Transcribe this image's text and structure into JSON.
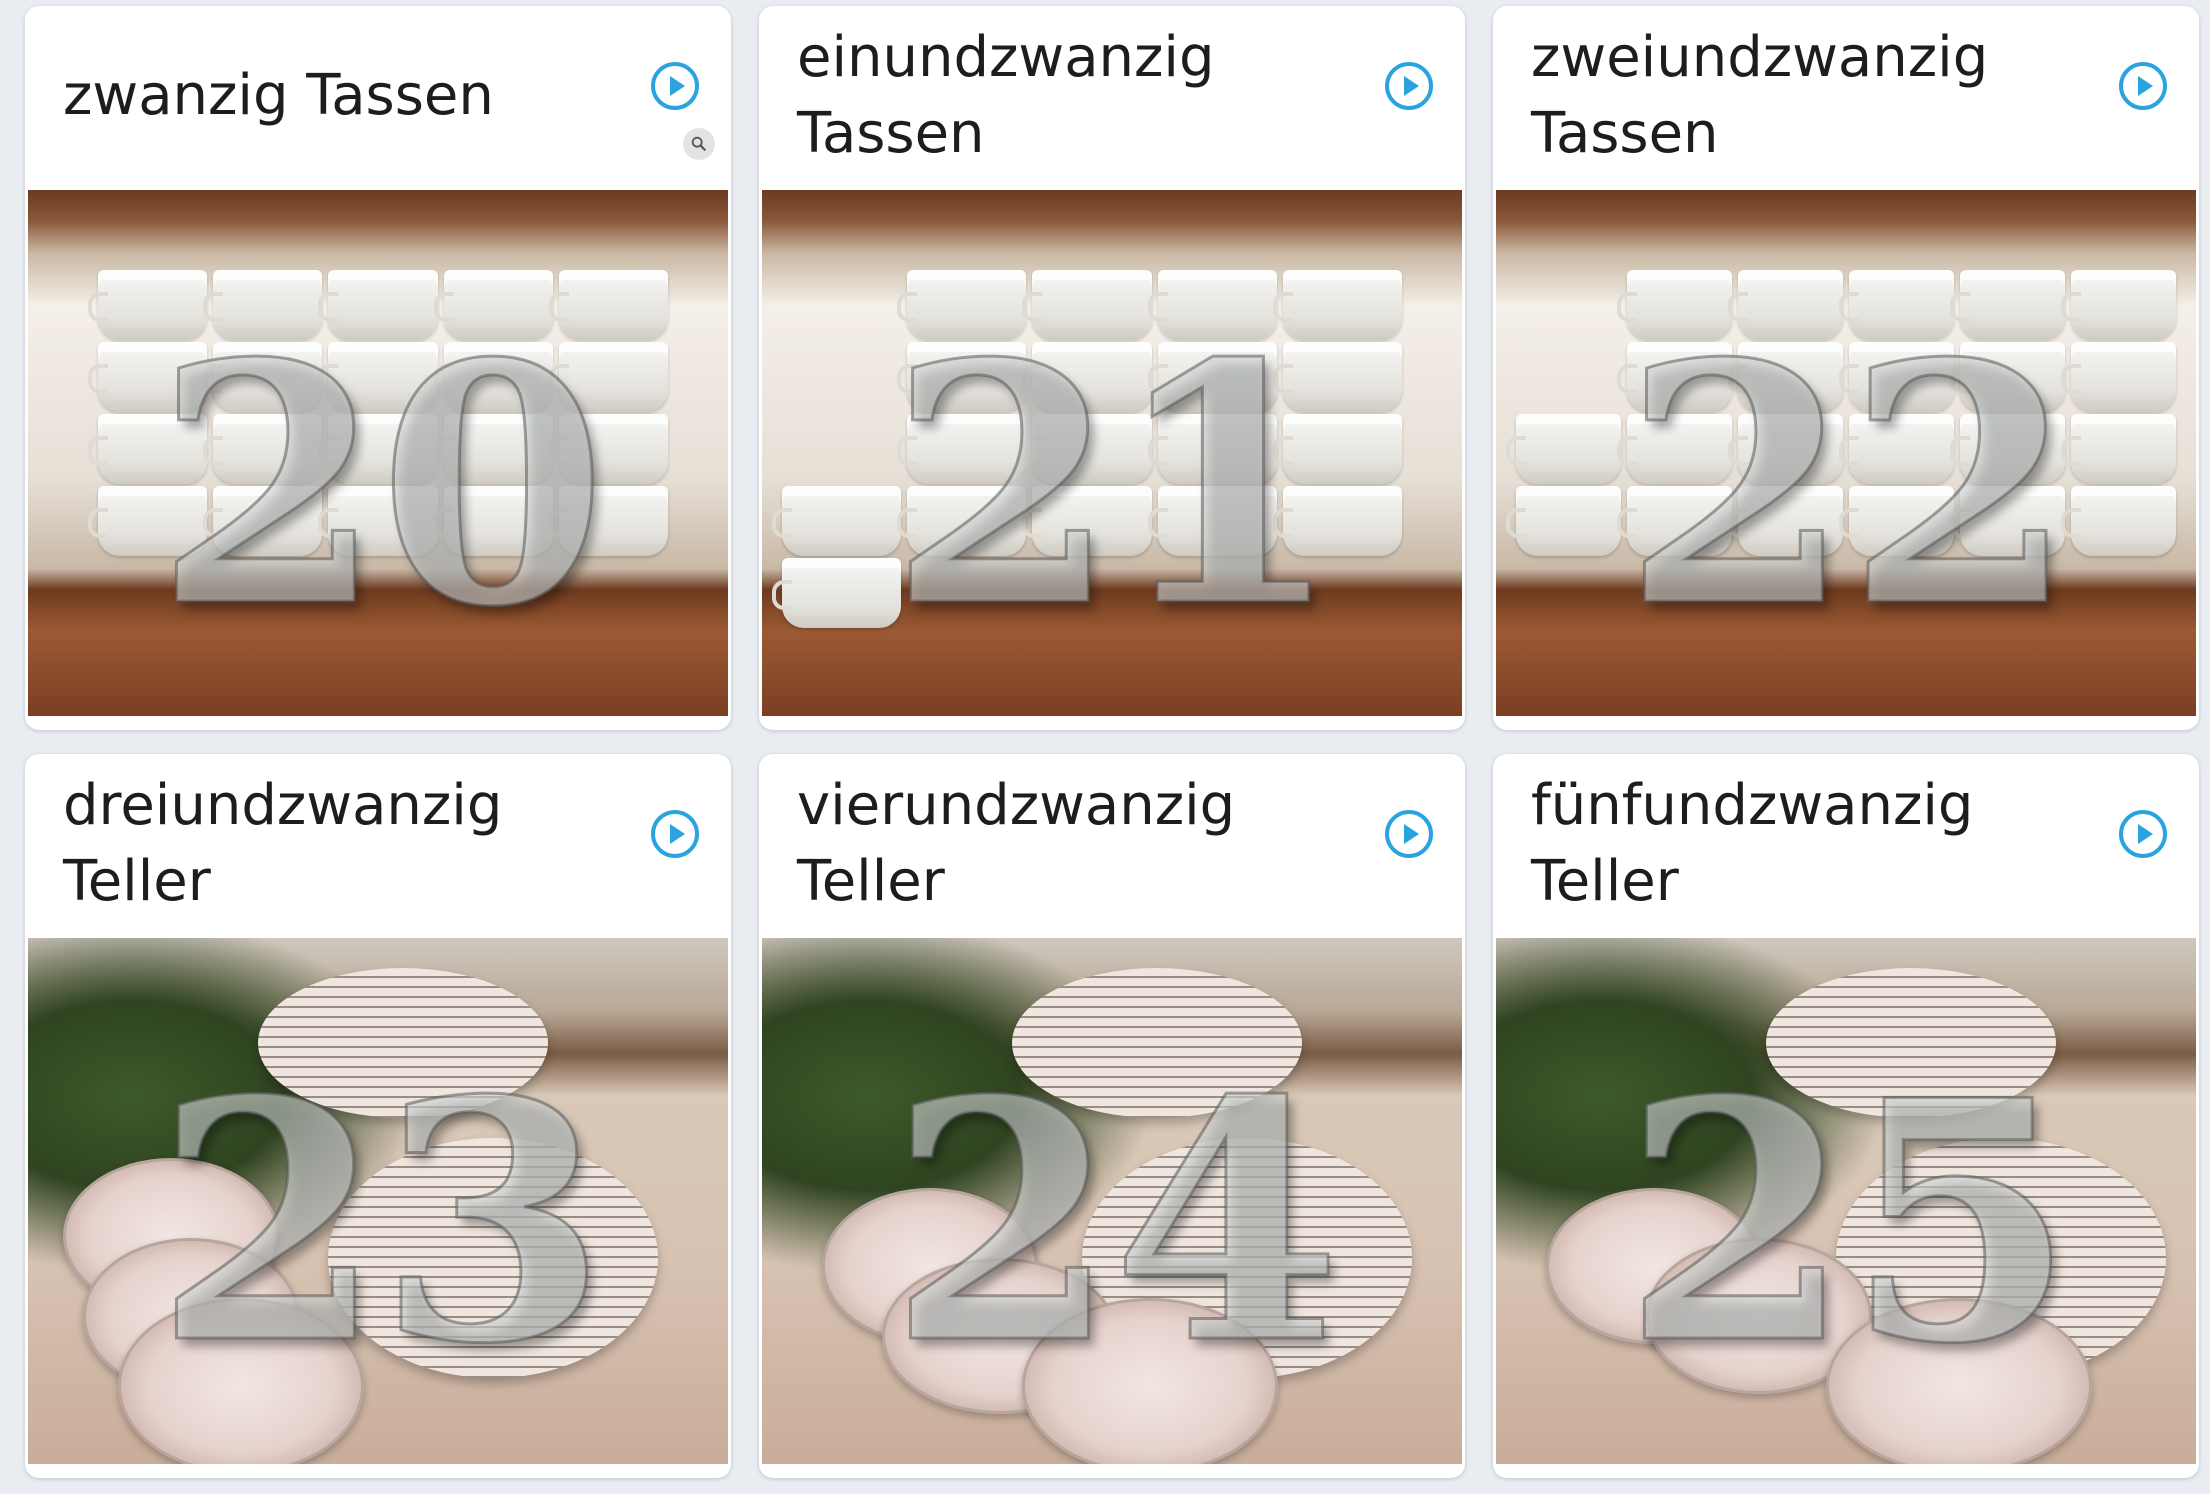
{
  "accent_color": "#2aa3df",
  "cards": [
    {
      "label": "zwanzig Tassen",
      "number": "20",
      "image": "cups",
      "play_icon": "play-icon"
    },
    {
      "label": "einundzwanzig\nTassen",
      "number": "21",
      "image": "cups",
      "play_icon": "play-icon"
    },
    {
      "label": "zweiundzwanzig\nTassen",
      "number": "22",
      "image": "cups",
      "play_icon": "play-icon"
    },
    {
      "label": "dreiundzwanzig\nTeller",
      "number": "23",
      "image": "plates",
      "play_icon": "play-icon"
    },
    {
      "label": "vierundzwanzig\nTeller",
      "number": "24",
      "image": "plates",
      "play_icon": "play-icon"
    },
    {
      "label": "fünfundzwanzig\nTeller",
      "number": "25",
      "image": "plates",
      "play_icon": "play-icon"
    }
  ],
  "zoom_icon": "magnify-icon"
}
